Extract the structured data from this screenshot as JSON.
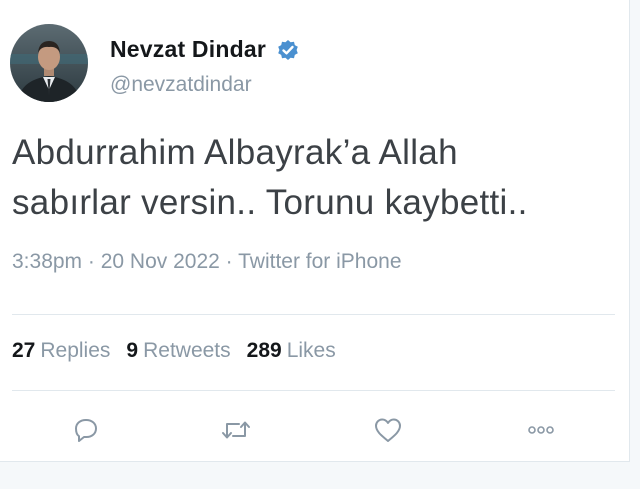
{
  "user": {
    "display_name": "Nevzat Dindar",
    "handle": "@nevzatdindar",
    "verified": true,
    "avatar_icon": "profile-photo"
  },
  "tweet": {
    "text_line1": "Abdurrahim Albayrak’a Allah",
    "text_line2": "sabırlar versin.. Torunu kaybetti.."
  },
  "meta": {
    "time": "3:38pm",
    "separator1": " · ",
    "date": "20 Nov 2022",
    "separator2": " · ",
    "source": "Twitter for iPhone"
  },
  "stats": {
    "replies_count": "27",
    "replies_label": "Replies",
    "retweets_count": "9",
    "retweets_label": "Retweets",
    "likes_count": "289",
    "likes_label": "Likes"
  },
  "actions": {
    "reply_icon": "reply-icon",
    "retweet_icon": "retweet-icon",
    "like_icon": "heart-icon",
    "more_icon": "more-icon"
  },
  "colors": {
    "verified_badge": "#4a90d0",
    "secondary_text": "#8a98a5",
    "primary_text": "#14171a",
    "icon_gray": "#8a98a5"
  }
}
